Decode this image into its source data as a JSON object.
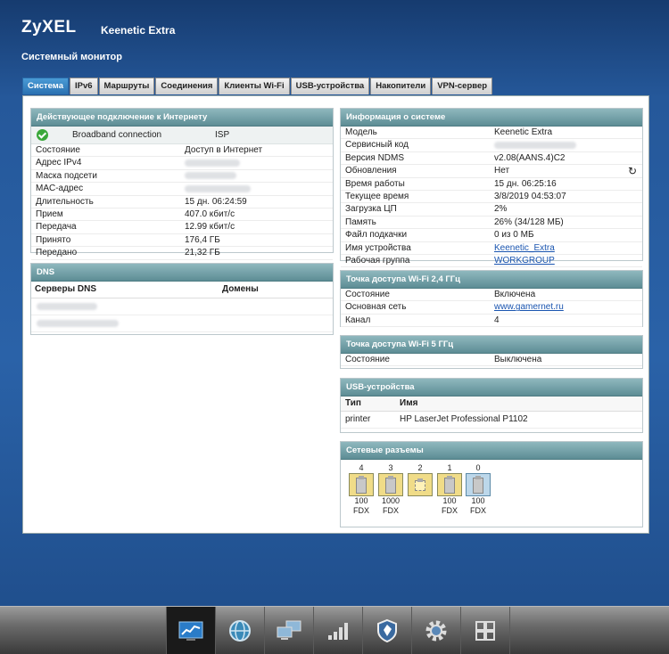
{
  "header": {
    "logo": "ZyXEL",
    "model": "Keenetic Extra",
    "page_title": "Системный монитор"
  },
  "tabs": [
    {
      "label": "Система",
      "active": true
    },
    {
      "label": "IPv6"
    },
    {
      "label": "Маршруты"
    },
    {
      "label": "Соединения"
    },
    {
      "label": "Клиенты Wi-Fi"
    },
    {
      "label": "USB-устройства"
    },
    {
      "label": "Накопители"
    },
    {
      "label": "VPN-сервер"
    }
  ],
  "internet": {
    "title": "Действующее подключение к Интернету",
    "connection_name": "Broadband connection",
    "connection_type": "ISP",
    "rows": [
      {
        "label": "Состояние",
        "value": "Доступ в Интернет"
      },
      {
        "label": "Адрес IPv4",
        "value": ""
      },
      {
        "label": "Маска подсети",
        "value": ""
      },
      {
        "label": "MAC-адрес",
        "value": ""
      },
      {
        "label": "Длительность",
        "value": "15 дн. 06:24:59"
      },
      {
        "label": "Прием",
        "value": "407.0 кбит/с"
      },
      {
        "label": "Передача",
        "value": "12.99 кбит/с"
      },
      {
        "label": "Принято",
        "value": "176,4 ГБ"
      },
      {
        "label": "Передано",
        "value": "21,32 ГБ"
      }
    ]
  },
  "dns": {
    "title": "DNS",
    "col_servers": "Серверы DNS",
    "col_domains": "Домены"
  },
  "system": {
    "title": "Информация о системе",
    "rows": [
      {
        "label": "Модель",
        "value": "Keenetic Extra"
      },
      {
        "label": "Сервисный код",
        "value": ""
      },
      {
        "label": "Версия NDMS",
        "value": "v2.08(AANS.4)C2"
      },
      {
        "label": "Обновления",
        "value": "Нет"
      },
      {
        "label": "Время работы",
        "value": "15 дн. 06:25:16"
      },
      {
        "label": "Текущее время",
        "value": "3/8/2019 04:53:07"
      },
      {
        "label": "Загрузка ЦП",
        "value": "2%"
      },
      {
        "label": "Память",
        "value": "26% (34/128 МБ)"
      },
      {
        "label": "Файл подкачки",
        "value": "0 из 0 МБ"
      },
      {
        "label": "Имя устройства",
        "value": "Keenetic_Extra",
        "link": true
      },
      {
        "label": "Рабочая группа",
        "value": "WORKGROUP",
        "link": true
      }
    ]
  },
  "wifi24": {
    "title": "Точка доступа Wi-Fi 2,4 ГГц",
    "rows": [
      {
        "label": "Состояние",
        "value": "Включена"
      },
      {
        "label": "Основная сеть",
        "value": "www.gamernet.ru",
        "link": true
      },
      {
        "label": "Канал",
        "value": "4"
      }
    ]
  },
  "wifi5": {
    "title": "Точка доступа Wi-Fi 5 ГГц",
    "rows": [
      {
        "label": "Состояние",
        "value": "Выключена"
      }
    ]
  },
  "usb": {
    "title": "USB-устройства",
    "col_type": "Тип",
    "col_name": "Имя",
    "devices": [
      {
        "type": "printer",
        "name": "HP LaserJet Professional P1102"
      }
    ]
  },
  "ports": {
    "title": "Сетевые разъемы",
    "items": [
      {
        "num": "4",
        "speed": "100",
        "duplex": "FDX",
        "state": "connected",
        "color": "#f0dc88"
      },
      {
        "num": "3",
        "speed": "1000",
        "duplex": "FDX",
        "state": "connected",
        "color": "#f0dc88"
      },
      {
        "num": "2",
        "speed": "",
        "duplex": "",
        "state": "empty",
        "color": "#f0dc88"
      },
      {
        "num": "1",
        "speed": "100",
        "duplex": "FDX",
        "state": "connected",
        "color": "#f0dc88"
      },
      {
        "num": "0",
        "speed": "100",
        "duplex": "FDX",
        "state": "connected",
        "color": "#bcd7ea"
      }
    ]
  },
  "dock": [
    {
      "icon": "monitor-chart-icon",
      "active": true
    },
    {
      "icon": "globe-icon"
    },
    {
      "icon": "network-computers-icon"
    },
    {
      "icon": "wifi-signal-bars-icon"
    },
    {
      "icon": "shield-icon"
    },
    {
      "icon": "gear-icon"
    },
    {
      "icon": "grid-icon"
    }
  ]
}
